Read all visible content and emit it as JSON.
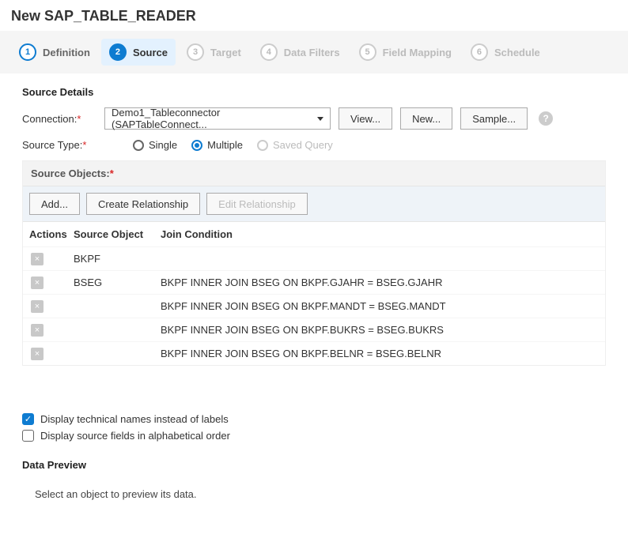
{
  "pageTitle": "New SAP_TABLE_READER",
  "wizard": {
    "steps": [
      {
        "num": "1",
        "label": "Definition"
      },
      {
        "num": "2",
        "label": "Source"
      },
      {
        "num": "3",
        "label": "Target"
      },
      {
        "num": "4",
        "label": "Data Filters"
      },
      {
        "num": "5",
        "label": "Field Mapping"
      },
      {
        "num": "6",
        "label": "Schedule"
      }
    ]
  },
  "sourceDetails": {
    "title": "Source Details",
    "connectionLabel": "Connection:",
    "connectionValue": "Demo1_Tableconnector (SAPTableConnect...",
    "viewBtn": "View...",
    "newBtn": "New...",
    "sampleBtn": "Sample...",
    "sourceTypeLabel": "Source Type:",
    "radios": {
      "single": "Single",
      "multiple": "Multiple",
      "savedQuery": "Saved Query"
    }
  },
  "sourceObjects": {
    "title": "Source Objects:",
    "addBtn": "Add...",
    "createRelBtn": "Create Relationship",
    "editRelBtn": "Edit Relationship",
    "headers": {
      "actions": "Actions",
      "src": "Source Object",
      "join": "Join Condition"
    },
    "rows": [
      {
        "src": "BKPF",
        "join": ""
      },
      {
        "src": "BSEG",
        "join": "BKPF INNER JOIN BSEG ON BKPF.GJAHR = BSEG.GJAHR"
      },
      {
        "src": "",
        "join": "BKPF INNER JOIN BSEG ON BKPF.MANDT = BSEG.MANDT"
      },
      {
        "src": "",
        "join": "BKPF INNER JOIN BSEG ON BKPF.BUKRS = BSEG.BUKRS"
      },
      {
        "src": "",
        "join": "BKPF INNER JOIN BSEG ON BKPF.BELNR = BSEG.BELNR"
      }
    ]
  },
  "options": {
    "technicalNames": "Display technical names instead of labels",
    "alphabetical": "Display source fields in alphabetical order"
  },
  "dataPreview": {
    "title": "Data Preview",
    "text": "Select an object to preview its data."
  }
}
